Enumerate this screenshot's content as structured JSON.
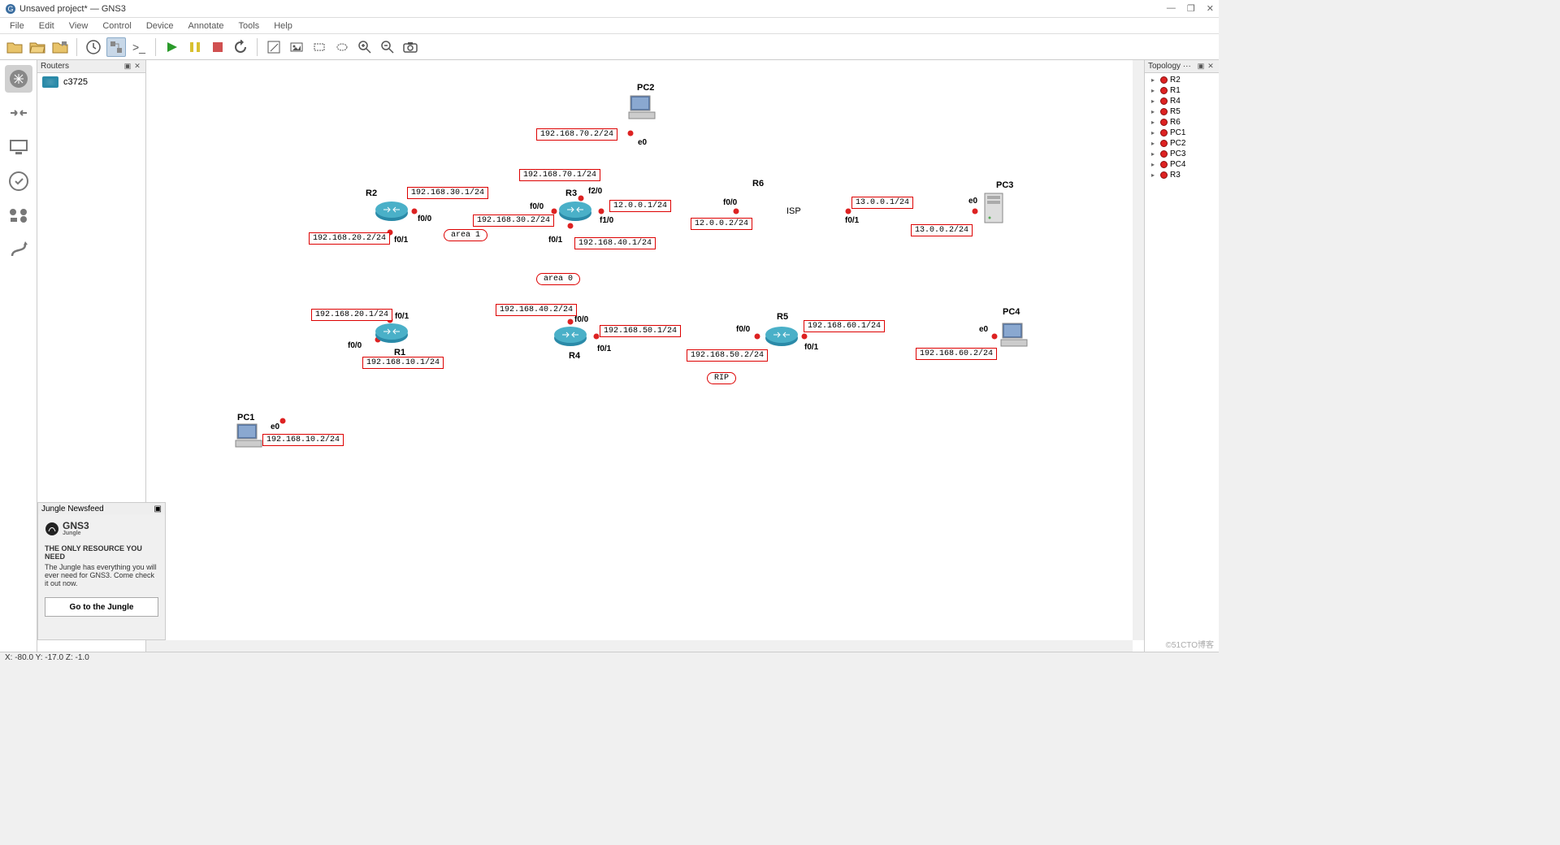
{
  "window": {
    "title": "Unsaved project* — GNS3"
  },
  "menus": [
    "File",
    "Edit",
    "View",
    "Control",
    "Device",
    "Annotate",
    "Tools",
    "Help"
  ],
  "panels": {
    "routers": {
      "title": "Routers",
      "item": "c3725"
    },
    "topology": {
      "title": "Topology ···",
      "items": [
        "R2",
        "R1",
        "R4",
        "R5",
        "R6",
        "PC1",
        "PC2",
        "PC3",
        "PC4",
        "R3"
      ]
    },
    "newsfeed": {
      "title": "Jungle Newsfeed",
      "logo_line1": "GNS3",
      "logo_line2": "Jungle",
      "headline": "THE ONLY RESOURCE YOU NEED",
      "body": "The Jungle has everything you will ever need for GNS3. Come check it out now.",
      "button": "Go to the Jungle"
    }
  },
  "statusbar": "X: -80.0 Y: -17.0 Z: -1.0",
  "watermark": "©51CTO博客",
  "diagram": {
    "nodes": {
      "R1": {
        "label": "R1"
      },
      "R2": {
        "label": "R2"
      },
      "R3": {
        "label": "R3"
      },
      "R4": {
        "label": "R4"
      },
      "R5": {
        "label": "R5"
      },
      "R6": {
        "label": "R6"
      },
      "PC1": {
        "label": "PC1"
      },
      "PC2": {
        "label": "PC2"
      },
      "PC3": {
        "label": "PC3"
      },
      "PC4": {
        "label": "PC4"
      },
      "ISP": {
        "label": "ISP"
      }
    },
    "areas": {
      "area0": "area 0",
      "area1": "area 1",
      "rip": "RIP"
    },
    "ports": {
      "pc1_e0": "e0",
      "pc2_e0": "e0",
      "pc3_e0": "e0",
      "pc4_e0": "e0",
      "r1_f00": "f0/0",
      "r1_f01": "f0/1",
      "r2_f00": "f0/0",
      "r2_f01": "f0/1",
      "r3_f00": "f0/0",
      "r3_f01": "f0/1",
      "r3_f10": "f1/0",
      "r3_f20": "f2/0",
      "r4_f00": "f0/0",
      "r4_f01": "f0/1",
      "r5_f00": "f0/0",
      "r5_f01": "f0/1",
      "r6_f00": "f0/0",
      "r6_f01": "f0/1"
    },
    "ips": {
      "pc1": "192.168.10.2/24",
      "r1_pc1": "192.168.10.1/24",
      "r1_r2": "192.168.20.1/24",
      "r2_r1": "192.168.20.2/24",
      "r2_r3": "192.168.30.1/24",
      "r3_r2": "192.168.30.2/24",
      "r3_pc2": "192.168.70.1/24",
      "pc2": "192.168.70.2/24",
      "r3_r4": "192.168.40.1/24",
      "r4_r3": "192.168.40.2/24",
      "r4_r5": "192.168.50.1/24",
      "r5_r4": "192.168.50.2/24",
      "r5_pc4": "192.168.60.1/24",
      "pc4": "192.168.60.2/24",
      "r3_r6": "12.0.0.1/24",
      "r6_r3": "12.0.0.2/24",
      "r6_pc3": "13.0.0.1/24",
      "pc3": "13.0.0.2/24"
    }
  }
}
